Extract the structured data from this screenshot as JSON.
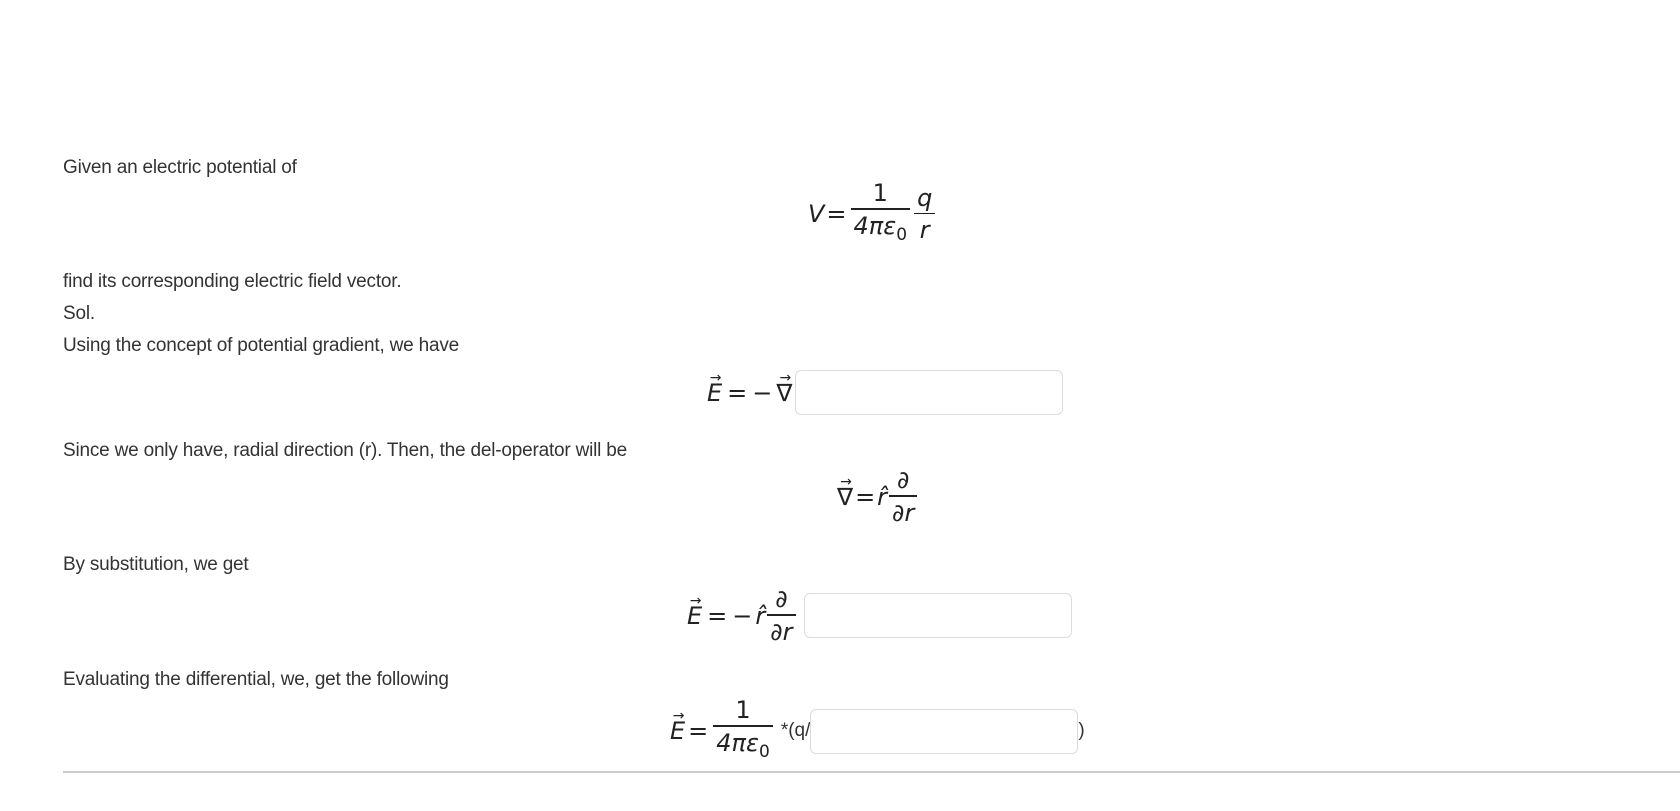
{
  "problem": {
    "intro": "Given an electric potential of",
    "equation_potential": {
      "lhs": "V",
      "equals": "=",
      "frac1_num": "1",
      "frac1_den": "4πε",
      "frac1_den_sub": "0",
      "frac2_num": "q",
      "frac2_den": "r"
    },
    "task": "find its corresponding electric field vector."
  },
  "solution": {
    "label": "Sol.",
    "step1_text": "Using the concept of potential gradient, we have",
    "step1_equation": {
      "lhs": "E",
      "arrow": "⃗",
      "arrow_glyph": "→",
      "equals": "=",
      "minus": "−",
      "nabla": "∇",
      "input_value": ""
    },
    "step2_text": "Since we only have, radial direction (r). Then, the del-operator will be",
    "step2_equation": {
      "nabla": "∇",
      "arrow_glyph": "→",
      "equals": "=",
      "rhat": "r̂",
      "partial_num": "∂",
      "partial_den": "∂r"
    },
    "step3_text": "By substitution, we get",
    "step3_equation": {
      "lhs": "E",
      "arrow_glyph": "→",
      "equals": "=",
      "minus": "−",
      "rhat": "r̂",
      "partial_num": "∂",
      "partial_den": "∂r",
      "input_value": ""
    },
    "step4_text": "Evaluating the differential, we, get the following",
    "step4_equation": {
      "lhs": "E",
      "arrow_glyph": "→",
      "equals": "=",
      "frac_num": "1",
      "frac_den": "4πε",
      "frac_den_sub": "0",
      "prefix_text": "*(q/",
      "suffix_text": ")",
      "input_value": ""
    }
  }
}
